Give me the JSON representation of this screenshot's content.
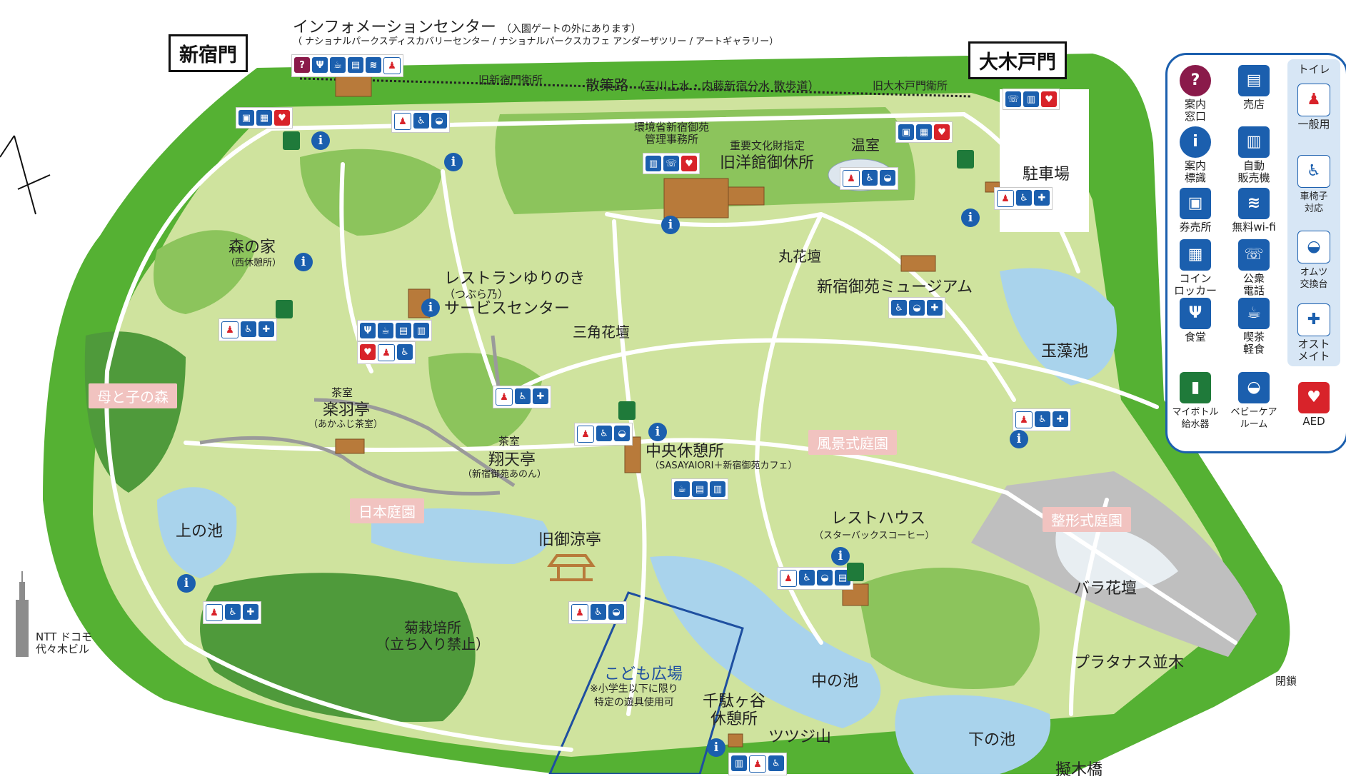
{
  "gates": {
    "shinjuku": "新宿門",
    "okido": "大木戸門"
  },
  "info_center": {
    "title": "インフォメーションセンター",
    "title_note": "（入園ゲートの外にあります）",
    "subtitle": "（ ナショナルパークスディスカバリーセンター / ナショナルパークスカフェ アンダーザツリー / アートギャラリー）"
  },
  "paths": {
    "old_shinjuku_gate": "旧新宿門衛所",
    "promenade": "散策路",
    "promenade_note": "（玉川上水・内藤新宿分水 散歩道）",
    "old_okido_gate": "旧大木戸門衛所"
  },
  "places": {
    "management_office": "環境省新宿御苑\n管理事務所",
    "important_property": "重要文化財指定",
    "old_western_rest": "旧洋館御休所",
    "greenhouse": "温室",
    "parking": "駐車場",
    "mori_no_ie": "森の家",
    "mori_no_ie_note": "（西休憩所）",
    "restaurant": "レストランゆりのき",
    "restaurant_note": "（つぶら乃）",
    "service_center": "サービスセンター",
    "maru_flowerbed": "丸花壇",
    "museum": "新宿御苑ミュージアム",
    "sankaku_flowerbed": "三角花壇",
    "gyokuso_pond": "玉藻池",
    "hahato_forest": "母と子の森",
    "teahouse_label": "茶室",
    "rakuutei": "楽羽亭",
    "rakuutei_note": "（あかふじ茶室）",
    "teahouse2_label": "茶室",
    "shotentei": "翔天亭",
    "shotentei_note": "（新宿御苑あのん）",
    "central_rest": "中央休憩所",
    "central_rest_note": "（SASAYAIORI＋新宿御苑カフェ）",
    "landscape_garden": "風景式庭園",
    "japanese_garden": "日本庭園",
    "upper_pond": "上の池",
    "old_goryotei": "旧御涼亭",
    "rest_house": "レストハウス",
    "rest_house_note": "（スターバックスコーヒー）",
    "formal_garden": "整形式庭園",
    "rose_bed": "バラ花壇",
    "platanus": "プラタナス並木",
    "closed": "閉鎖",
    "ntt_building": "NTT ドコモ\n代々木ビル",
    "chrysanthemum": "菊栽培所\n（立ち入り禁止）",
    "kids_plaza": "こども広場",
    "kids_note": "※小学生以下に限り\n特定の遊具使用可",
    "sendagaya_rest": "千駄ヶ谷\n休憩所",
    "middle_pond": "中の池",
    "tsutsuji_hill": "ツツジ山",
    "lower_pond": "下の池",
    "bridge": "擬木橋"
  },
  "legend": {
    "items": [
      {
        "icon": "question-icon",
        "label": "案内\n窓口"
      },
      {
        "icon": "shop-icon",
        "label": "売店"
      },
      {
        "icon": "info-icon",
        "label": "案内\n標識"
      },
      {
        "icon": "vending-icon",
        "label": "自動\n販売機"
      },
      {
        "icon": "ticket-icon",
        "label": "券売所"
      },
      {
        "icon": "wifi-icon",
        "label": "無料wi-fi"
      },
      {
        "icon": "locker-icon",
        "label": "コイン\nロッカー"
      },
      {
        "icon": "phone-icon",
        "label": "公衆\n電話"
      },
      {
        "icon": "restaurant-icon",
        "label": "食堂"
      },
      {
        "icon": "cafe-icon",
        "label": "喫茶\n軽食"
      },
      {
        "icon": "bottle-icon",
        "label": "マイボトル\n給水器"
      },
      {
        "icon": "baby-care-icon",
        "label": "ベビーケア\nルーム"
      }
    ],
    "toilet_header": "トイレ",
    "toilet_items": [
      {
        "icon": "toilet-icon",
        "label": "一般用"
      },
      {
        "icon": "wheelchair-icon",
        "label": "車椅子\n対応"
      },
      {
        "icon": "diaper-icon",
        "label": "オムツ\n交換台"
      },
      {
        "icon": "ostomate-icon",
        "label": "オスト\nメイト"
      },
      {
        "icon": "aed-icon",
        "label": "AED"
      }
    ]
  },
  "colors": {
    "outer_green": "#55b133",
    "lawn": "#cfe39e",
    "forest": "#8cc45c",
    "path": "#ffffff",
    "water": "#a9d3ec",
    "legend_border": "#1b5fae",
    "zone_label_bg": "#f1c3c0"
  }
}
